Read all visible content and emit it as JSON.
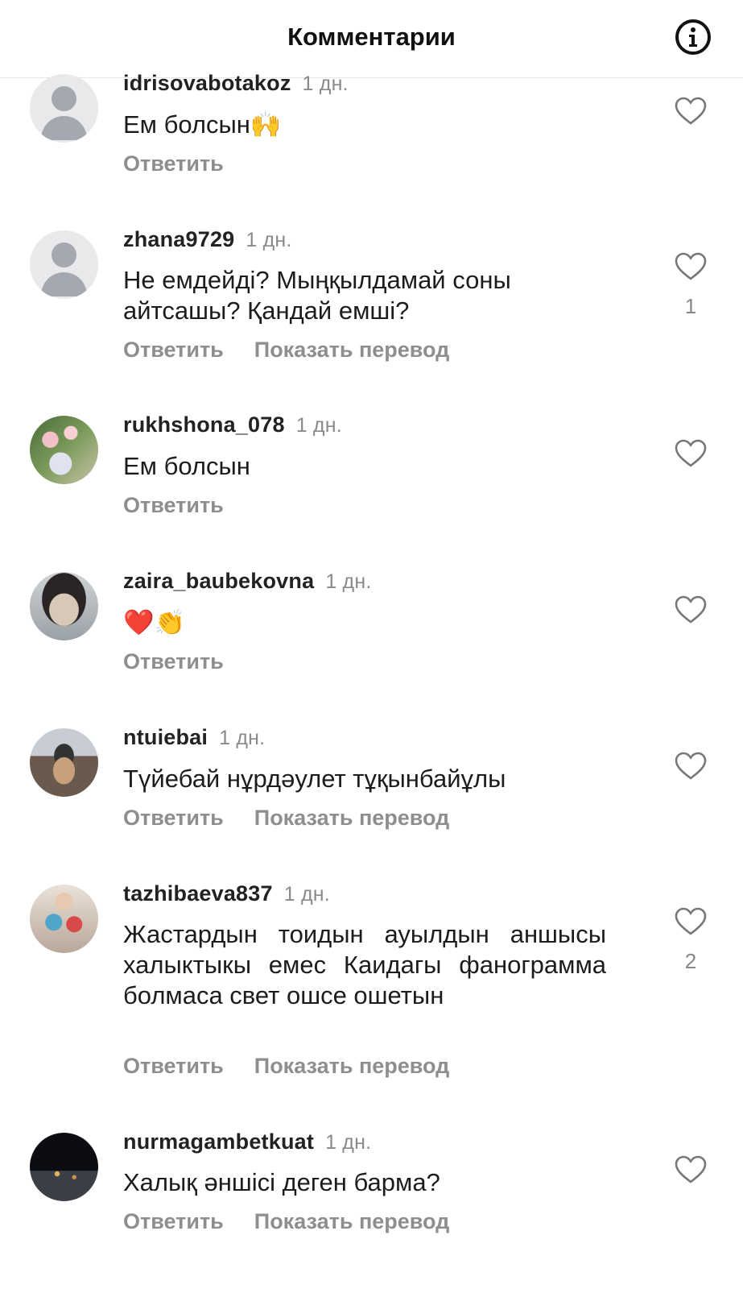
{
  "header": {
    "title": "Комментарии",
    "info_icon": "info-icon"
  },
  "comments": [
    {
      "username": "idrisovabotakoz",
      "time": "1 дн.",
      "text": "Ем болсын🙌",
      "reply": "Ответить",
      "likes": ""
    },
    {
      "username": "zhana9729",
      "time": "1 дн.",
      "text": "Не емдейді? Мыңқылдамай соны айтсашы? Қандай емші?",
      "reply": "Ответить",
      "translate": "Показать перевод",
      "likes": "1"
    },
    {
      "username": "rukhshona_078",
      "time": "1 дн.",
      "text": "Ем болсын",
      "reply": "Ответить",
      "likes": ""
    },
    {
      "username": "zaira_baubekovna",
      "time": "1 дн.",
      "text": "❤️👏",
      "reply": "Ответить",
      "likes": ""
    },
    {
      "username": "ntuiebai",
      "time": "1 дн.",
      "text": "Түйебай нұрдәулет тұқынбайұлы",
      "reply": "Ответить",
      "translate": "Показать перевод",
      "likes": ""
    },
    {
      "username": "tazhibaeva837",
      "time": "1 дн.",
      "text": "Жастардын тоидын ауылдын аншысы халыктыкы емес Каидагы фанограмма болмаса свет ошсе ошетын",
      "reply": "Ответить",
      "translate": "Показать перевод",
      "likes": "2"
    },
    {
      "username": "nurmagambetkuat",
      "time": "1 дн.",
      "text": "Халық әншісі деген барма?",
      "reply": "Ответить",
      "translate": "Показать перевод",
      "likes": ""
    }
  ]
}
